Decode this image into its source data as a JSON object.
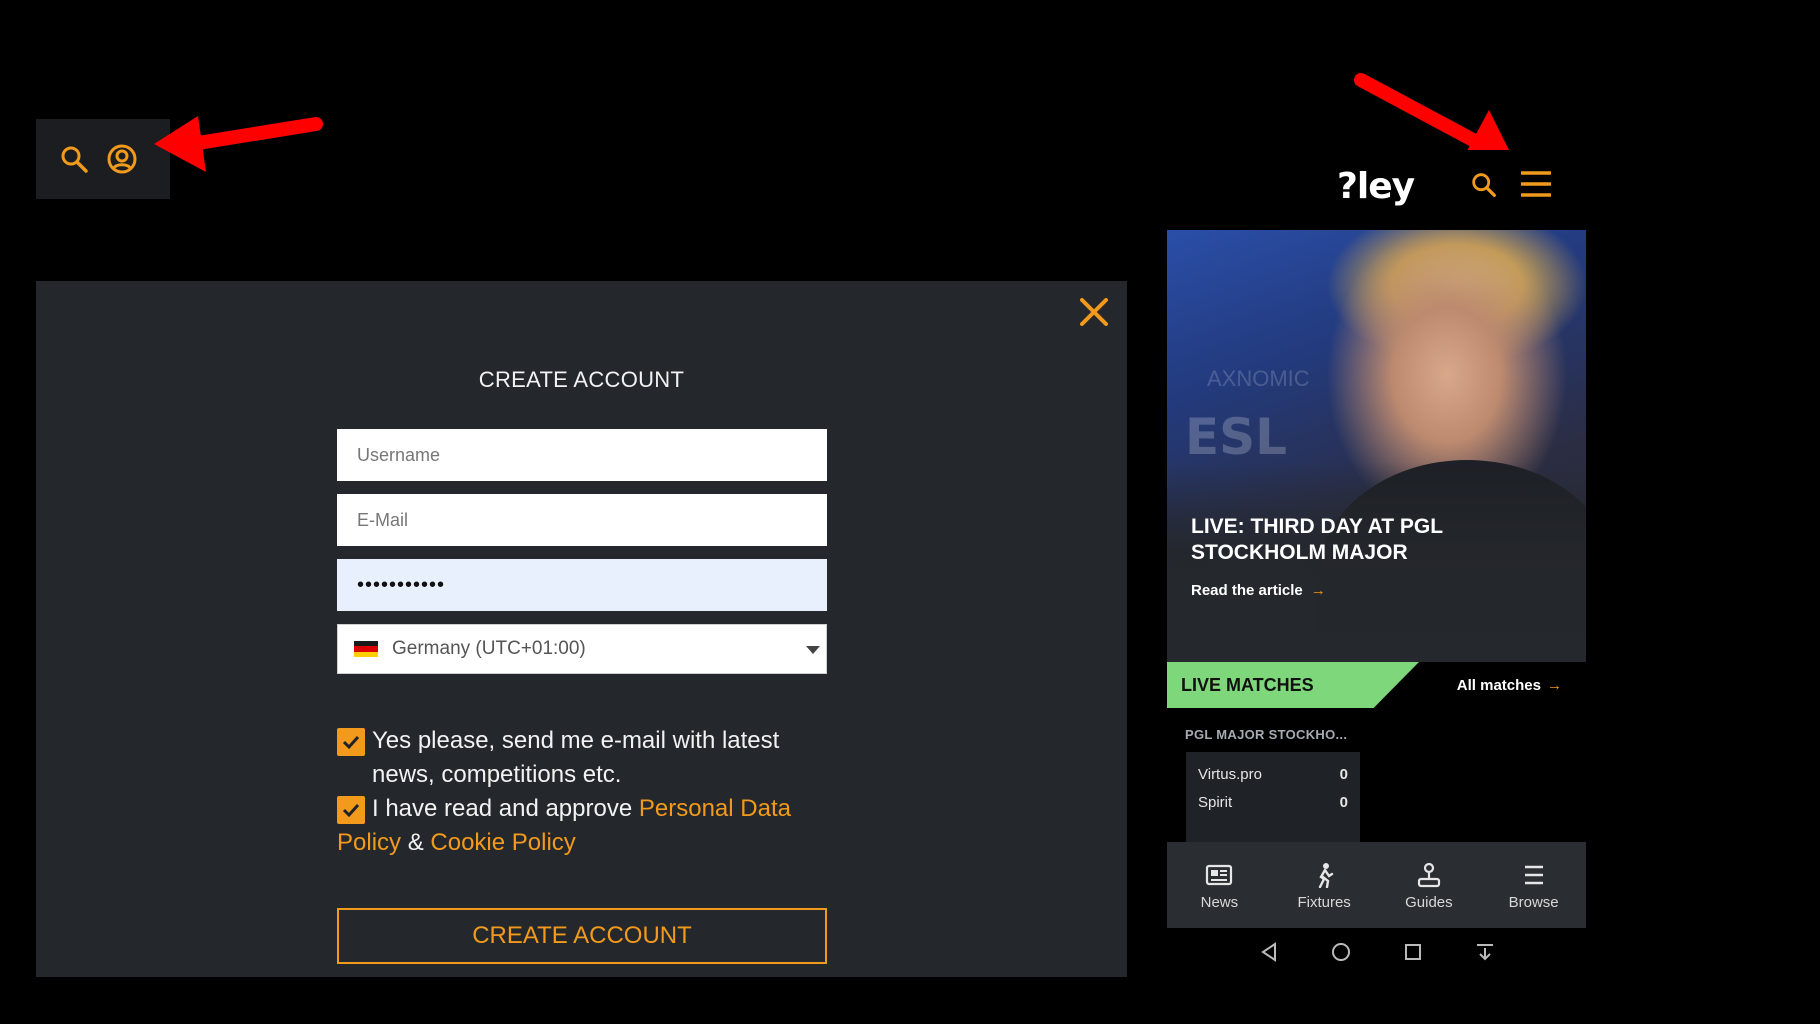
{
  "desktop_toolbar": {
    "icons": [
      "search-icon",
      "user-icon"
    ]
  },
  "modal": {
    "title": "CREATE ACCOUNT",
    "username_placeholder": "Username",
    "email_placeholder": "E-Mail",
    "password_value": "•••••••••••",
    "timezone_value": "Germany (UTC+01:00)",
    "newsletter_text_line1": "Yes please, send me e-mail with latest",
    "newsletter_text_line2": "news, competitions etc.",
    "newsletter_checked": true,
    "policy_prefix": "I have read and approve",
    "policy_link1": "Personal Data Policy",
    "policy_amp": "&",
    "policy_link2": "Cookie Policy",
    "policy_checked": true,
    "submit_label": "CREATE ACCOUNT",
    "accent_color": "#f19a1c"
  },
  "phone": {
    "logo": "?ley",
    "hero": {
      "bg_text_1": "AXNOMIC",
      "bg_text_2": "ESL",
      "title": "LIVE: THIRD DAY AT PGL STOCKHOLM MAJOR",
      "link": "Read the article",
      "link_arrow": "→"
    },
    "live": {
      "tab_label": "LIVE MATCHES",
      "all_matches": "All matches",
      "arrow": "→",
      "tab_color": "#7ed87b",
      "tournament": "PGL MAJOR STOCKHO...",
      "teams": [
        {
          "name": "Virtus.pro",
          "score": "0"
        },
        {
          "name": "Spirit",
          "score": "0"
        }
      ]
    },
    "nav": [
      {
        "label": "News",
        "icon": "newspaper-icon"
      },
      {
        "label": "Fixtures",
        "icon": "player-icon"
      },
      {
        "label": "Guides",
        "icon": "joystick-icon"
      },
      {
        "label": "Browse",
        "icon": "menu-icon"
      }
    ],
    "system_nav": [
      "back-icon",
      "home-icon",
      "recents-icon",
      "notification-icon"
    ]
  }
}
